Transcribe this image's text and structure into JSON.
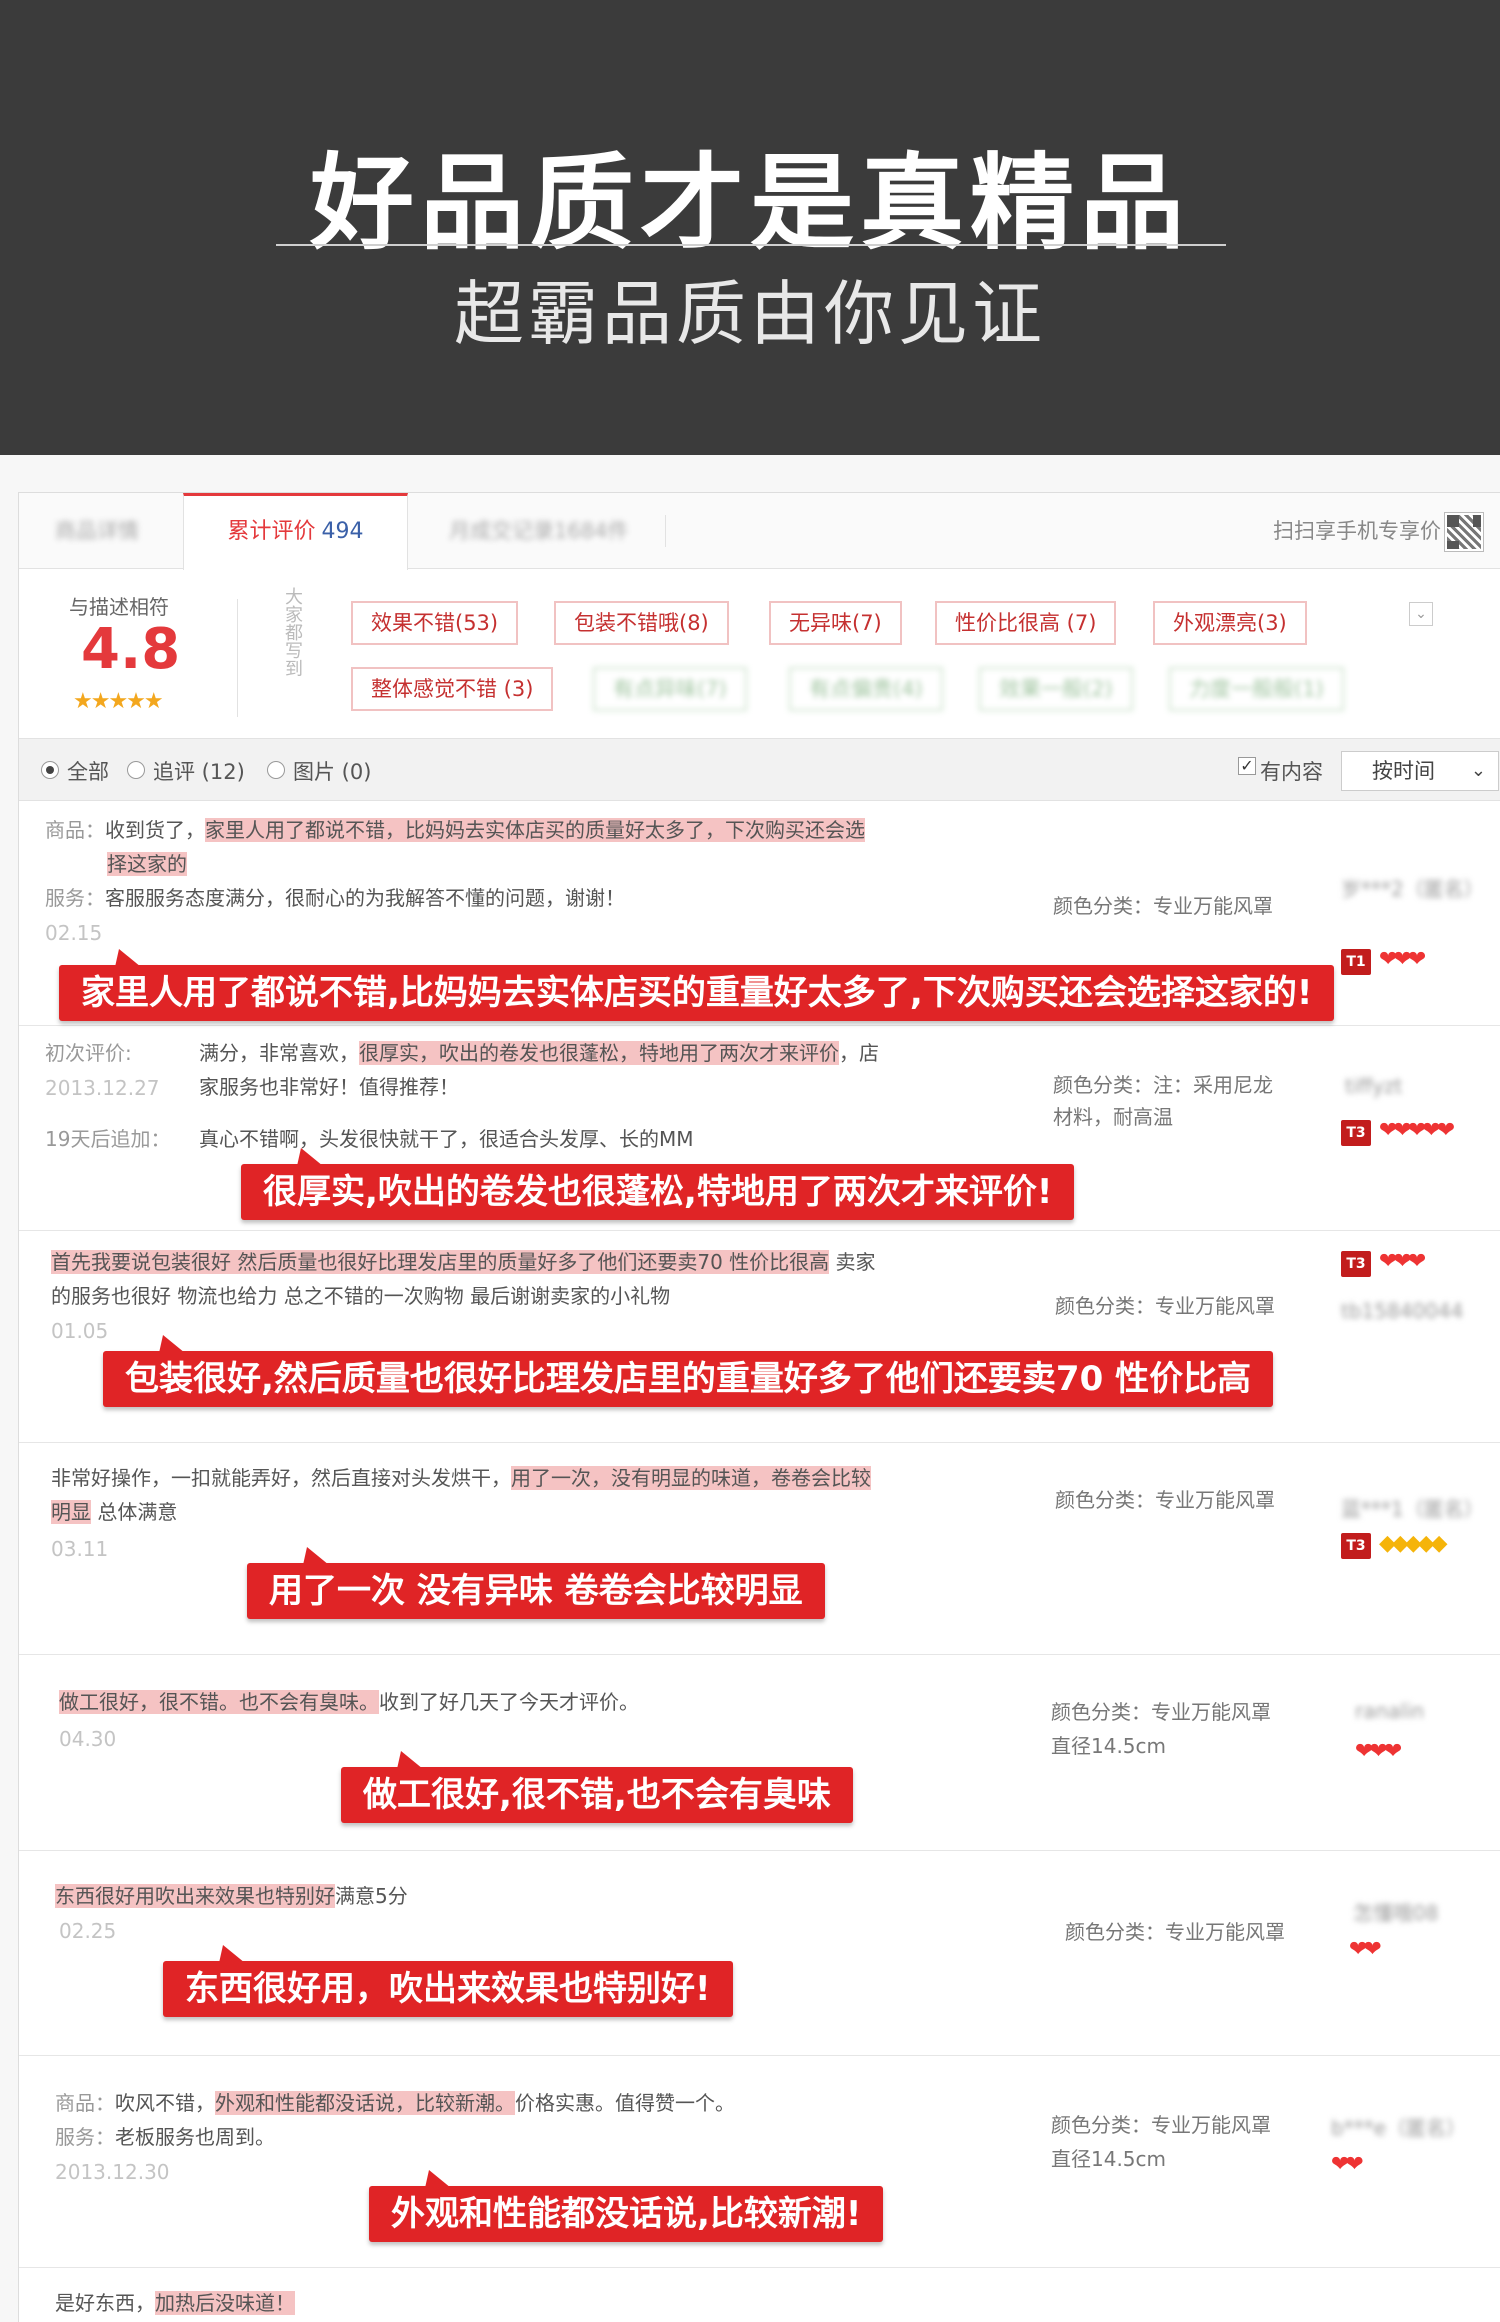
{
  "banner": {
    "title": "好品质才是真精品",
    "subtitle": "超霸品质由你见证"
  },
  "tabs": {
    "product_detail": "商品详情",
    "reviews_label": "累计评价",
    "reviews_count": "494",
    "monthly_sales": "月成交记录1684件",
    "scan_text": "扫扫享手机专享价"
  },
  "score": {
    "label": "与描述相符",
    "value": "4.8",
    "stars": "★★★★★",
    "vertical_label": "大家都写到"
  },
  "tags": {
    "visible": [
      "效果不错(53)",
      "包装不错哦(8)",
      "无异味(7)",
      "性价比很高 (7)",
      "外观漂亮(3)",
      "整体感觉不错 (3)"
    ],
    "blurred": [
      "有点异味(7)",
      "有点偏贵(4)",
      "效果一般(2)",
      "力度一般般(1)"
    ]
  },
  "filter": {
    "all": "全部",
    "followup": "追评 (12)",
    "pictures": "图片 (0)",
    "has_content": "有内容",
    "sort": "按时间"
  },
  "reviews": [
    {
      "line1_key": "商品：",
      "line1_pre": "收到货了，",
      "line1_hl": "家里人用了都说不错，比妈妈去实体店买的质量好太多了，下次购买还会选",
      "line2_hl": "择这家的",
      "line3_key": "服务：",
      "line3_text": "客服服务态度满分，很耐心的为我解答不懂的问题，谢谢！",
      "date": "02.15",
      "meta": "颜色分类：专业万能风罩",
      "user": "岁***2（匿名）",
      "badge": "T1",
      "hearts": "❤❤❤",
      "callout": "家里人用了都说不错,比妈妈去实体店买的重量好太多了,下次购买还会选择这家的!"
    },
    {
      "first_label": "初次评价:",
      "first_date": "2013.12.27",
      "line1_pre": "满分，非常喜欢，",
      "line1_hl": "很厚实，吹出的卷发也很蓬松，特地用了两次才来评价",
      "line1_post": "，店",
      "line2": "家服务也非常好！值得推荐！",
      "add_label": "19天后追加：",
      "add_text": "真心不错啊，头发很快就干了，很适合头发厚、长的MM",
      "meta1": "颜色分类：注：采用尼龙",
      "meta2": "材料，耐高温",
      "user": "tiffyzt",
      "badge": "T3",
      "hearts": "❤❤❤❤❤",
      "callout": "很厚实,吹出的卷发也很蓬松,特地用了两次才来评价!"
    },
    {
      "line1_hl": "首先我要说包装很好 然后质量也很好比理发店里的质量好多了他们还要卖70 性价比很高",
      "line1_post": " 卖家",
      "line2": "的服务也很好 物流也给力 总之不错的一次购物 最后谢谢卖家的小礼物",
      "date": "01.05",
      "meta": "颜色分类：专业万能风罩",
      "user": "tb15840044",
      "badge": "T3",
      "hearts": "❤❤❤",
      "callout": "包装很好,然后质量也很好比理发店里的重量好多了他们还要卖70 性价比高"
    },
    {
      "line1_pre": "非常好操作，一扣就能弄好，然后直接对头发烘干，",
      "line1_hl": "用了一次，没有明显的味道，卷卷会比较",
      "line2_hl": "明显",
      "line2_post": " 总体满意",
      "date": "03.11",
      "meta": "颜色分类：专业万能风罩",
      "user": "蓝***1（匿名）",
      "badge": "T3",
      "hearts": "◆◆◆◆◆",
      "callout": "用了一次 没有异味 卷卷会比较明显"
    },
    {
      "line1_hl": "做工很好，很不错。也不会有臭味。",
      "line1_post": "收到了好几天了今天才评价。",
      "date": "04.30",
      "meta1": "颜色分类：专业万能风罩",
      "meta2": "直径14.5cm",
      "user": "ranalin",
      "hearts": "❤❤❤",
      "callout": "做工很好,很不错,也不会有臭味"
    },
    {
      "line1_hl": "东西很好用吹出来效果也特别好",
      "line1_post": "满意5分",
      "date": "02.25",
      "meta": "颜色分类：专业万能风罩",
      "user": "怎懂哦08",
      "hearts": "❤❤",
      "callout": "东西很好用，吹出来效果也特别好!"
    },
    {
      "line1_key": "商品：",
      "line1_pre": "吹风不错，",
      "line1_hl": "外观和性能都没话说，比较新潮。",
      "line1_post": "价格实惠。值得赞一个。",
      "line2_key": "服务：",
      "line2_text": "老板服务也周到。",
      "date": "2013.12.30",
      "meta1": "颜色分类：专业万能风罩",
      "meta2": "直径14.5cm",
      "user": "b***e（匿名）",
      "hearts": "❤❤",
      "callout": "外观和性能都没话说,比较新潮!"
    },
    {
      "line1_pre": "是好东西，",
      "line1_hl": "加热后没味道！"
    }
  ]
}
